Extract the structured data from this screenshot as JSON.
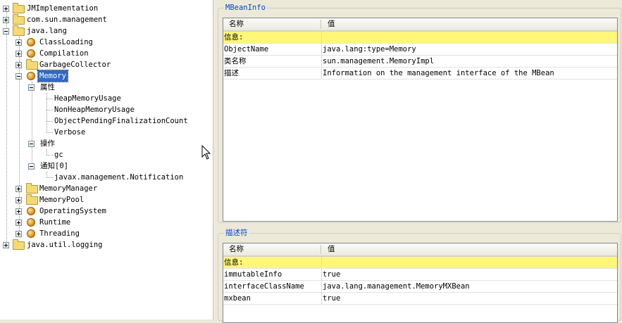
{
  "tree": {
    "items": [
      {
        "label": "JMImplementation",
        "icon": "folder-icon",
        "expander": "plus"
      },
      {
        "label": "com.sun.management",
        "icon": "folder-icon",
        "expander": "plus"
      },
      {
        "label": "java.lang",
        "icon": "folder-icon",
        "expander": "minus"
      },
      {
        "label": "ClassLoading",
        "icon": "bean-icon",
        "expander": "plus"
      },
      {
        "label": "Compilation",
        "icon": "bean-icon",
        "expander": "plus"
      },
      {
        "label": "GarbageCollector",
        "icon": "folder-icon",
        "expander": "plus"
      },
      {
        "label": "Memory",
        "icon": "bean-icon",
        "expander": "minus",
        "selected": true
      },
      {
        "label": "属性",
        "expander": "minus"
      },
      {
        "label": "HeapMemoryUsage"
      },
      {
        "label": "NonHeapMemoryUsage"
      },
      {
        "label": "ObjectPendingFinalizationCount"
      },
      {
        "label": "Verbose"
      },
      {
        "label": "操作",
        "expander": "minus"
      },
      {
        "label": "gc"
      },
      {
        "label": "通知[0]",
        "expander": "minus"
      },
      {
        "label": "javax.management.Notification"
      },
      {
        "label": "MemoryManager",
        "icon": "folder-icon",
        "expander": "plus"
      },
      {
        "label": "MemoryPool",
        "icon": "folder-icon",
        "expander": "plus"
      },
      {
        "label": "OperatingSystem",
        "icon": "bean-icon",
        "expander": "plus"
      },
      {
        "label": "Runtime",
        "icon": "bean-icon",
        "expander": "plus"
      },
      {
        "label": "Threading",
        "icon": "bean-icon",
        "expander": "plus"
      },
      {
        "label": "java.util.logging",
        "icon": "folder-icon",
        "expander": "plus"
      }
    ]
  },
  "mbeaninfo": {
    "title": "MBeanInfo",
    "col_name": "名称",
    "col_value": "值",
    "rows": [
      {
        "k": "信息:",
        "v": "",
        "info": true
      },
      {
        "k": "ObjectName",
        "v": "java.lang:type=Memory"
      },
      {
        "k": "类名称",
        "v": "sun.management.MemoryImpl"
      },
      {
        "k": "描述",
        "v": "Information on the management interface of the MBean"
      }
    ]
  },
  "descriptor": {
    "title": "描述符",
    "col_name": "名称",
    "col_value": "值",
    "rows": [
      {
        "k": "信息:",
        "v": "",
        "info": true
      },
      {
        "k": "immutableInfo",
        "v": "true"
      },
      {
        "k": "interfaceClassName",
        "v": "java.lang.management.MemoryMXBean"
      },
      {
        "k": "mxbean",
        "v": "true"
      }
    ]
  },
  "colors": {
    "selection": "#316ac5",
    "info_row": "#fff67a",
    "group_title": "#0046d5"
  }
}
